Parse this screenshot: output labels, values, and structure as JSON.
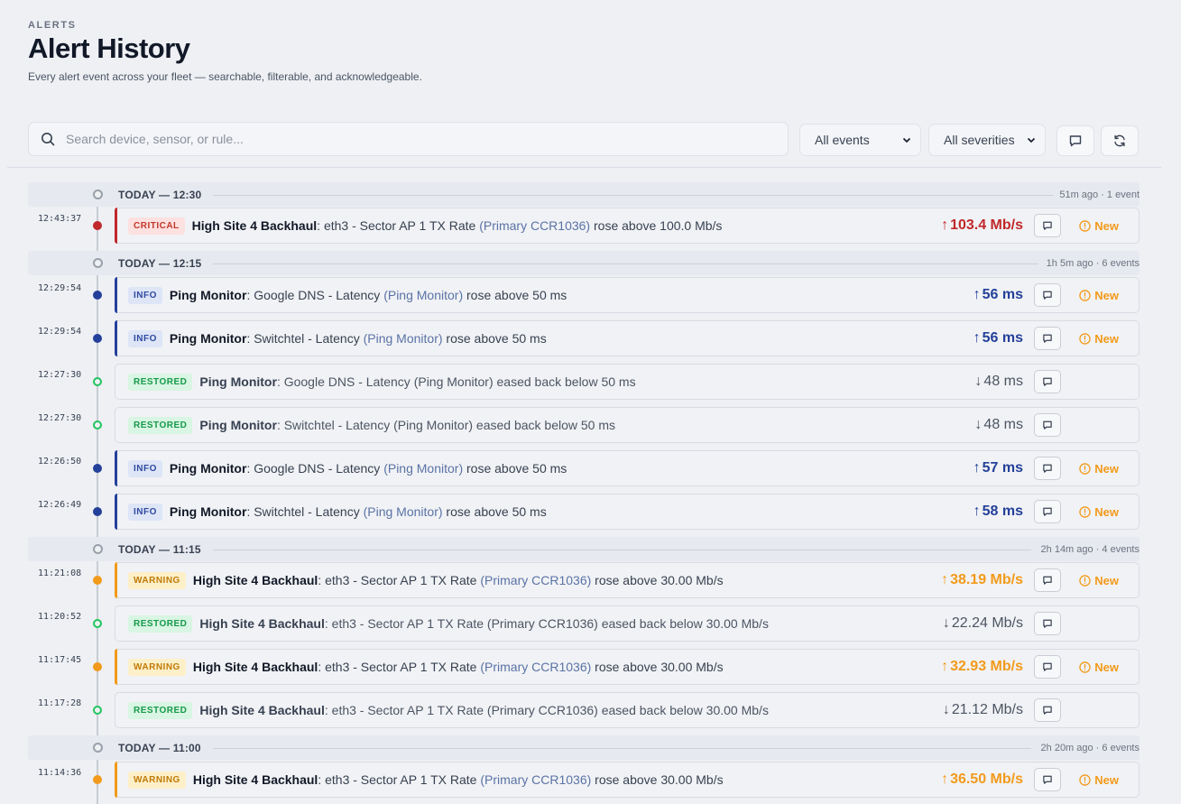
{
  "header": {
    "eyebrow": "ALERTS",
    "title": "Alert History",
    "subtitle": "Every alert event across your fleet — searchable, filterable, and acknowledgeable."
  },
  "toolbar": {
    "search_placeholder": "Search device, sensor, or rule...",
    "events_filter": "All events",
    "severity_filter": "All severities"
  },
  "colors": {
    "critical": "#c0282a",
    "info": "#24409a",
    "warning": "#f29a1b",
    "restored": "#22c55e"
  },
  "groups": [
    {
      "label": "TODAY — 12:30",
      "meta": "51m ago · 1 event",
      "events": [
        {
          "time": "12:43:37",
          "severity": "critical",
          "badge": "CRITICAL",
          "device": "High Site 4 Backhaul",
          "sensor": "eth3 - Sector AP 1 TX Rate",
          "source": "(Primary CCR1036)",
          "action": "rose above 100.0 Mb/s",
          "arrow": "↑",
          "value": "103.4 Mb/s",
          "status": "New"
        }
      ]
    },
    {
      "label": "TODAY — 12:15",
      "meta": "1h 5m ago · 6 events",
      "events": [
        {
          "time": "12:29:54",
          "severity": "info",
          "badge": "INFO",
          "device": "Ping Monitor",
          "sensor": "Google DNS - Latency",
          "source": "(Ping Monitor)",
          "action": "rose above 50 ms",
          "arrow": "↑",
          "value": "56 ms",
          "status": "New"
        },
        {
          "time": "12:29:54",
          "severity": "info",
          "badge": "INFO",
          "device": "Ping Monitor",
          "sensor": "Switchtel - Latency",
          "source": "(Ping Monitor)",
          "action": "rose above 50 ms",
          "arrow": "↑",
          "value": "56 ms",
          "status": "New"
        },
        {
          "time": "12:27:30",
          "severity": "restored",
          "badge": "RESTORED",
          "device": "Ping Monitor",
          "sensor": "Google DNS - Latency",
          "source": "(Ping Monitor)",
          "action": "eased back below 50 ms",
          "arrow": "↓",
          "value": "48 ms",
          "status": ""
        },
        {
          "time": "12:27:30",
          "severity": "restored",
          "badge": "RESTORED",
          "device": "Ping Monitor",
          "sensor": "Switchtel - Latency",
          "source": "(Ping Monitor)",
          "action": "eased back below 50 ms",
          "arrow": "↓",
          "value": "48 ms",
          "status": ""
        },
        {
          "time": "12:26:50",
          "severity": "info",
          "badge": "INFO",
          "device": "Ping Monitor",
          "sensor": "Google DNS - Latency",
          "source": "(Ping Monitor)",
          "action": "rose above 50 ms",
          "arrow": "↑",
          "value": "57 ms",
          "status": "New"
        },
        {
          "time": "12:26:49",
          "severity": "info",
          "badge": "INFO",
          "device": "Ping Monitor",
          "sensor": "Switchtel - Latency",
          "source": "(Ping Monitor)",
          "action": "rose above 50 ms",
          "arrow": "↑",
          "value": "58 ms",
          "status": "New"
        }
      ]
    },
    {
      "label": "TODAY — 11:15",
      "meta": "2h 14m ago · 4 events",
      "events": [
        {
          "time": "11:21:08",
          "severity": "warning",
          "badge": "WARNING",
          "device": "High Site 4 Backhaul",
          "sensor": "eth3 - Sector AP 1 TX Rate",
          "source": "(Primary CCR1036)",
          "action": "rose above 30.00 Mb/s",
          "arrow": "↑",
          "value": "38.19 Mb/s",
          "status": "New"
        },
        {
          "time": "11:20:52",
          "severity": "restored",
          "badge": "RESTORED",
          "device": "High Site 4 Backhaul",
          "sensor": "eth3 - Sector AP 1 TX Rate",
          "source": "(Primary CCR1036)",
          "action": "eased back below 30.00 Mb/s",
          "arrow": "↓",
          "value": "22.24 Mb/s",
          "status": ""
        },
        {
          "time": "11:17:45",
          "severity": "warning",
          "badge": "WARNING",
          "device": "High Site 4 Backhaul",
          "sensor": "eth3 - Sector AP 1 TX Rate",
          "source": "(Primary CCR1036)",
          "action": "rose above 30.00 Mb/s",
          "arrow": "↑",
          "value": "32.93 Mb/s",
          "status": "New"
        },
        {
          "time": "11:17:28",
          "severity": "restored",
          "badge": "RESTORED",
          "device": "High Site 4 Backhaul",
          "sensor": "eth3 - Sector AP 1 TX Rate",
          "source": "(Primary CCR1036)",
          "action": "eased back below 30.00 Mb/s",
          "arrow": "↓",
          "value": "21.12 Mb/s",
          "status": ""
        }
      ]
    },
    {
      "label": "TODAY — 11:00",
      "meta": "2h 20m ago · 6 events",
      "events": [
        {
          "time": "11:14:36",
          "severity": "warning",
          "badge": "WARNING",
          "device": "High Site 4 Backhaul",
          "sensor": "eth3 - Sector AP 1 TX Rate",
          "source": "(Primary CCR1036)",
          "action": "rose above 30.00 Mb/s",
          "arrow": "↑",
          "value": "36.50 Mb/s",
          "status": "New"
        }
      ]
    }
  ]
}
